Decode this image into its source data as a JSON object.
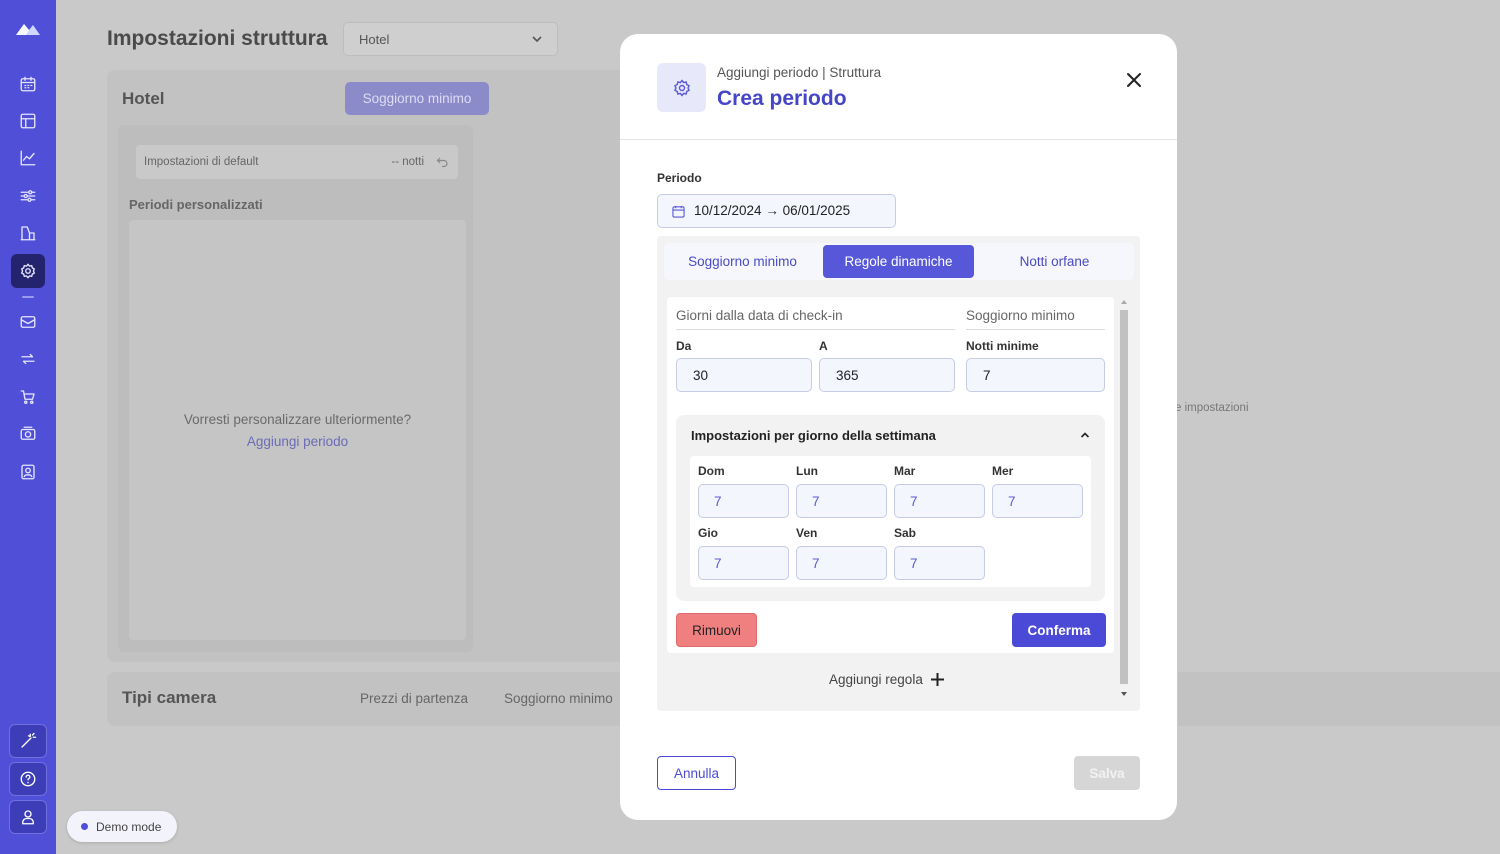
{
  "sidebar": {
    "items": [
      "calendar-icon",
      "layout-icon",
      "chart-icon",
      "sliders-icon",
      "buildings-icon",
      "gear-icon",
      "mail-icon",
      "sync-icon",
      "cart-icon",
      "camera-icon",
      "contact-icon"
    ],
    "active": "gear-icon",
    "bottom": [
      "magic-wand-icon",
      "help-icon",
      "user-icon"
    ]
  },
  "background": {
    "title": "Impostazioni struttura",
    "select_value": "Hotel",
    "hotel_card_title": "Hotel",
    "tab_button": "Soggiorno minimo",
    "default_label": "Impostazioni di default",
    "default_value": "-- notti",
    "custom_periods_title": "Periodi personalizzati",
    "empty_text": "Vorresti personalizzare ulteriormente?",
    "add_period_link": "Aggiungi periodo",
    "right_hint": "e impostazioni",
    "camera_card_title": "Tipi camera",
    "camera_tab_1": "Prezzi di partenza",
    "camera_tab_2": "Soggiorno minimo"
  },
  "demo_mode": "Demo mode",
  "modal": {
    "subtitle": "Aggiungi periodo | Struttura",
    "title": "Crea periodo",
    "period_label": "Periodo",
    "period_value": "10/12/2024 → 06/01/2025",
    "tabs": [
      {
        "label": "Soggiorno minimo",
        "active": false
      },
      {
        "label": "Regole dinamiche",
        "active": true
      },
      {
        "label": "Notti orfane",
        "active": false
      }
    ],
    "rule": {
      "col1_header": "Giorni dalla data di check-in",
      "col2_header": "Soggiorno minimo",
      "from_label": "Da",
      "from_value": "30",
      "to_label": "A",
      "to_value": "365",
      "min_nights_label": "Notti minime",
      "min_nights_value": "7",
      "week_title": "Impostazioni per giorno della settimana",
      "days": [
        {
          "label": "Dom",
          "value": "7"
        },
        {
          "label": "Lun",
          "value": "7"
        },
        {
          "label": "Mar",
          "value": "7"
        },
        {
          "label": "Mer",
          "value": "7"
        },
        {
          "label": "Gio",
          "value": "7"
        },
        {
          "label": "Ven",
          "value": "7"
        },
        {
          "label": "Sab",
          "value": "7"
        }
      ],
      "remove_button": "Rimuovi",
      "confirm_button": "Conferma"
    },
    "add_rule": "Aggiungi regola",
    "cancel_button": "Annulla",
    "save_button": "Salva"
  },
  "colors": {
    "brand": "#4f4fd8",
    "accent": "#4545c8",
    "danger": "#f08080"
  }
}
